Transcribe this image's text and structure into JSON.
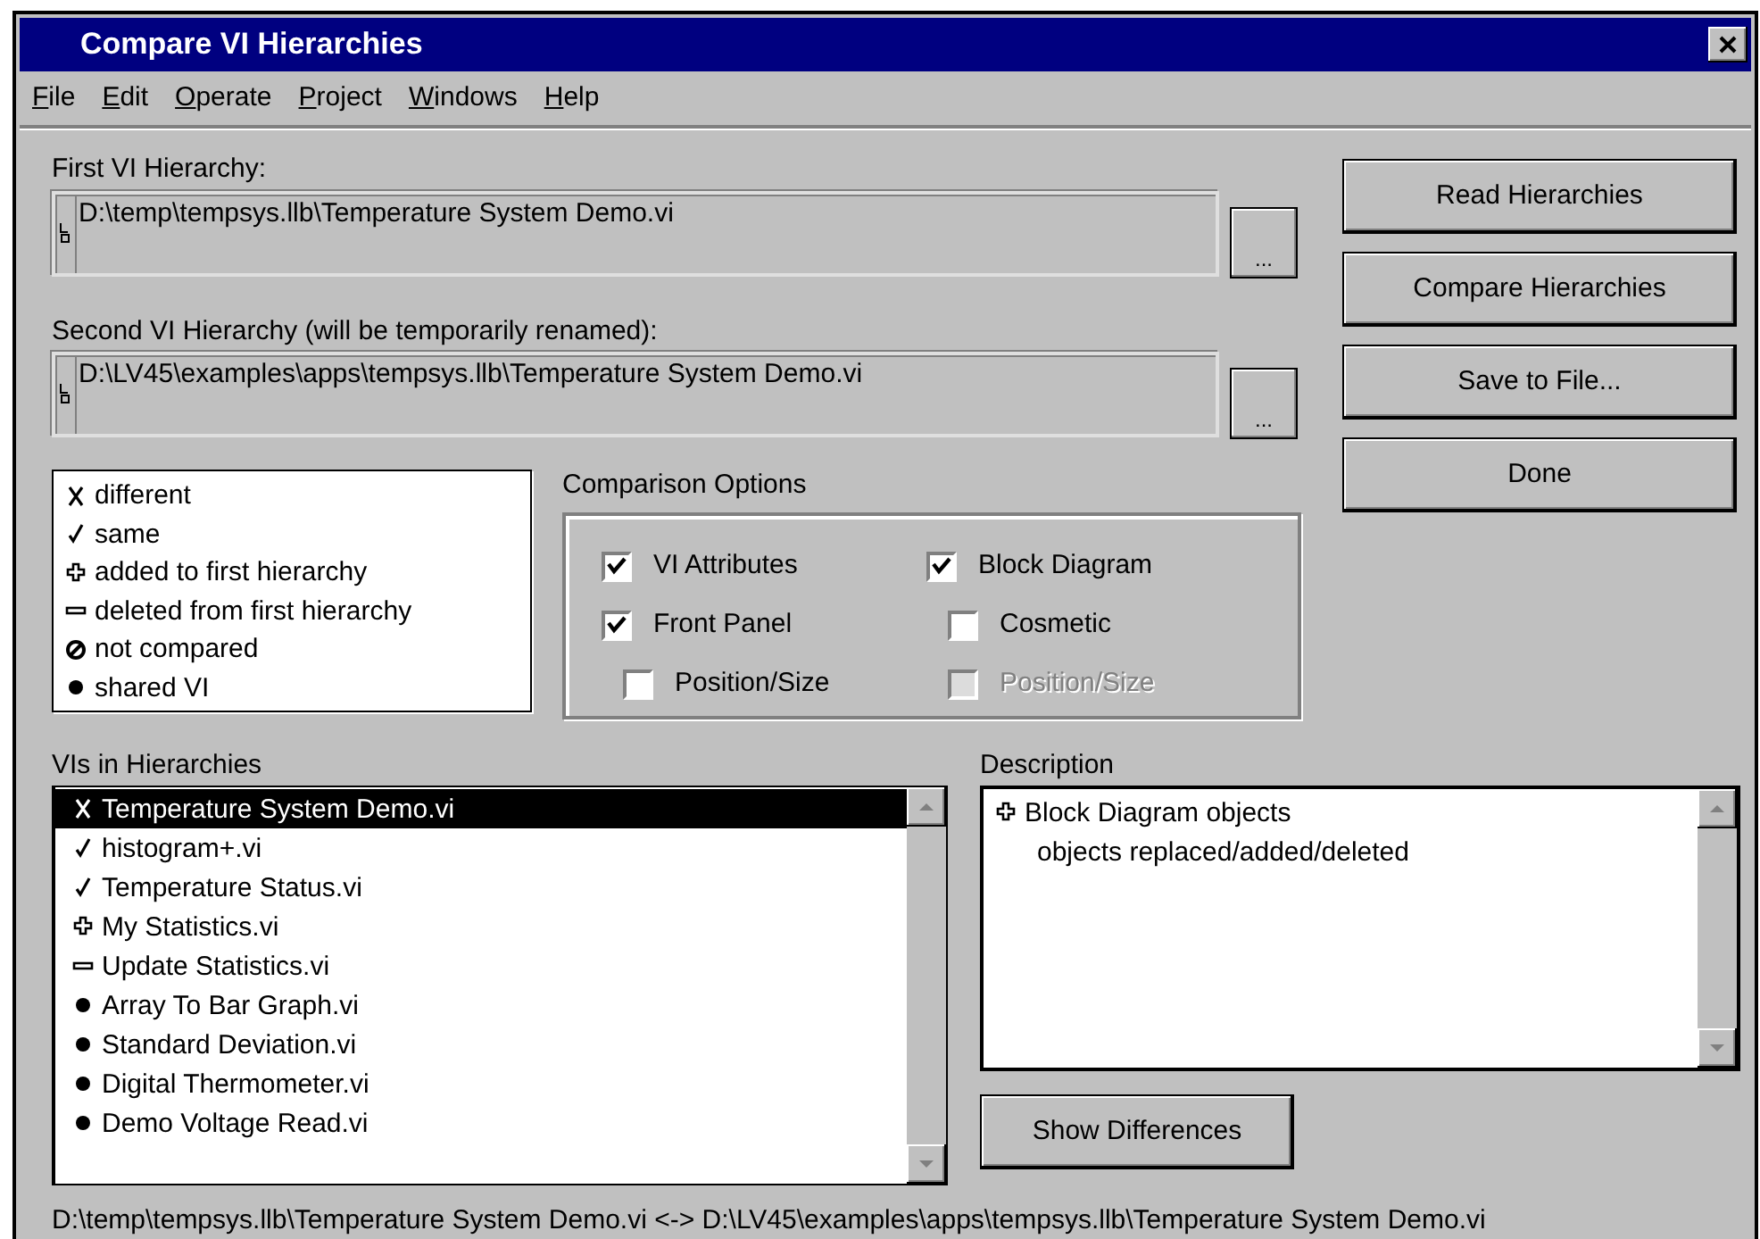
{
  "window": {
    "title": "Compare VI Hierarchies"
  },
  "menu": [
    {
      "label": "File"
    },
    {
      "label": "Edit"
    },
    {
      "label": "Operate"
    },
    {
      "label": "Project"
    },
    {
      "label": "Windows"
    },
    {
      "label": "Help"
    }
  ],
  "hierarchies": [
    {
      "label": "First VI Hierarchy:",
      "path": "D:\\temp\\tempsys.llb\\Temperature System Demo.vi",
      "browse": "..."
    },
    {
      "label": "Second VI Hierarchy (will be temporarily renamed):",
      "path": "D:\\LV45\\examples\\apps\\tempsys.llb\\Temperature System Demo.vi",
      "browse": "..."
    }
  ],
  "buttons": [
    "Read Hierarchies",
    "Compare Hierarchies",
    "Save to File...",
    "Done"
  ],
  "legend": [
    {
      "kind": "different",
      "label": "different"
    },
    {
      "kind": "same",
      "label": "same"
    },
    {
      "kind": "added",
      "label": "added to first hierarchy"
    },
    {
      "kind": "deleted",
      "label": "deleted from first hierarchy"
    },
    {
      "kind": "not_compared",
      "label": "not compared"
    },
    {
      "kind": "shared",
      "label": "shared VI"
    }
  ],
  "comparison_options": {
    "title": "Comparison Options",
    "columns": [
      [
        {
          "label": "VI Attributes",
          "checked": true,
          "disabled": false
        },
        {
          "label": "Front Panel",
          "checked": true,
          "disabled": false,
          "children": [
            {
              "label": "Position/Size",
              "checked": false,
              "disabled": false
            }
          ]
        }
      ],
      [
        {
          "label": "Block Diagram",
          "checked": true,
          "disabled": false,
          "children": [
            {
              "label": "Cosmetic",
              "checked": false,
              "disabled": false
            },
            {
              "label": "Position/Size",
              "checked": false,
              "disabled": true
            }
          ]
        }
      ]
    ]
  },
  "vis": {
    "title": "VIs in Hierarchies",
    "items": [
      {
        "kind": "different",
        "label": "Temperature System Demo.vi",
        "selected": true
      },
      {
        "kind": "same",
        "label": "histogram+.vi",
        "selected": false
      },
      {
        "kind": "same",
        "label": "Temperature Status.vi",
        "selected": false
      },
      {
        "kind": "added",
        "label": "My Statistics.vi",
        "selected": false
      },
      {
        "kind": "deleted",
        "label": "Update Statistics.vi",
        "selected": false
      },
      {
        "kind": "shared",
        "label": "Array To Bar Graph.vi",
        "selected": false
      },
      {
        "kind": "shared",
        "label": "Standard Deviation.vi",
        "selected": false
      },
      {
        "kind": "shared",
        "label": "Digital Thermometer.vi",
        "selected": false
      },
      {
        "kind": "shared",
        "label": "Demo Voltage Read.vi",
        "selected": false
      }
    ]
  },
  "description": {
    "title": "Description",
    "items": [
      {
        "kind": "added",
        "label": "Block Diagram objects",
        "children": [
          {
            "label": "objects replaced/added/deleted"
          }
        ]
      }
    ]
  },
  "show_differences": "Show Differences",
  "status_bar": "D:\\temp\\tempsys.llb\\Temperature System Demo.vi <-> D:\\LV45\\examples\\apps\\tempsys.llb\\Temperature System Demo.vi"
}
